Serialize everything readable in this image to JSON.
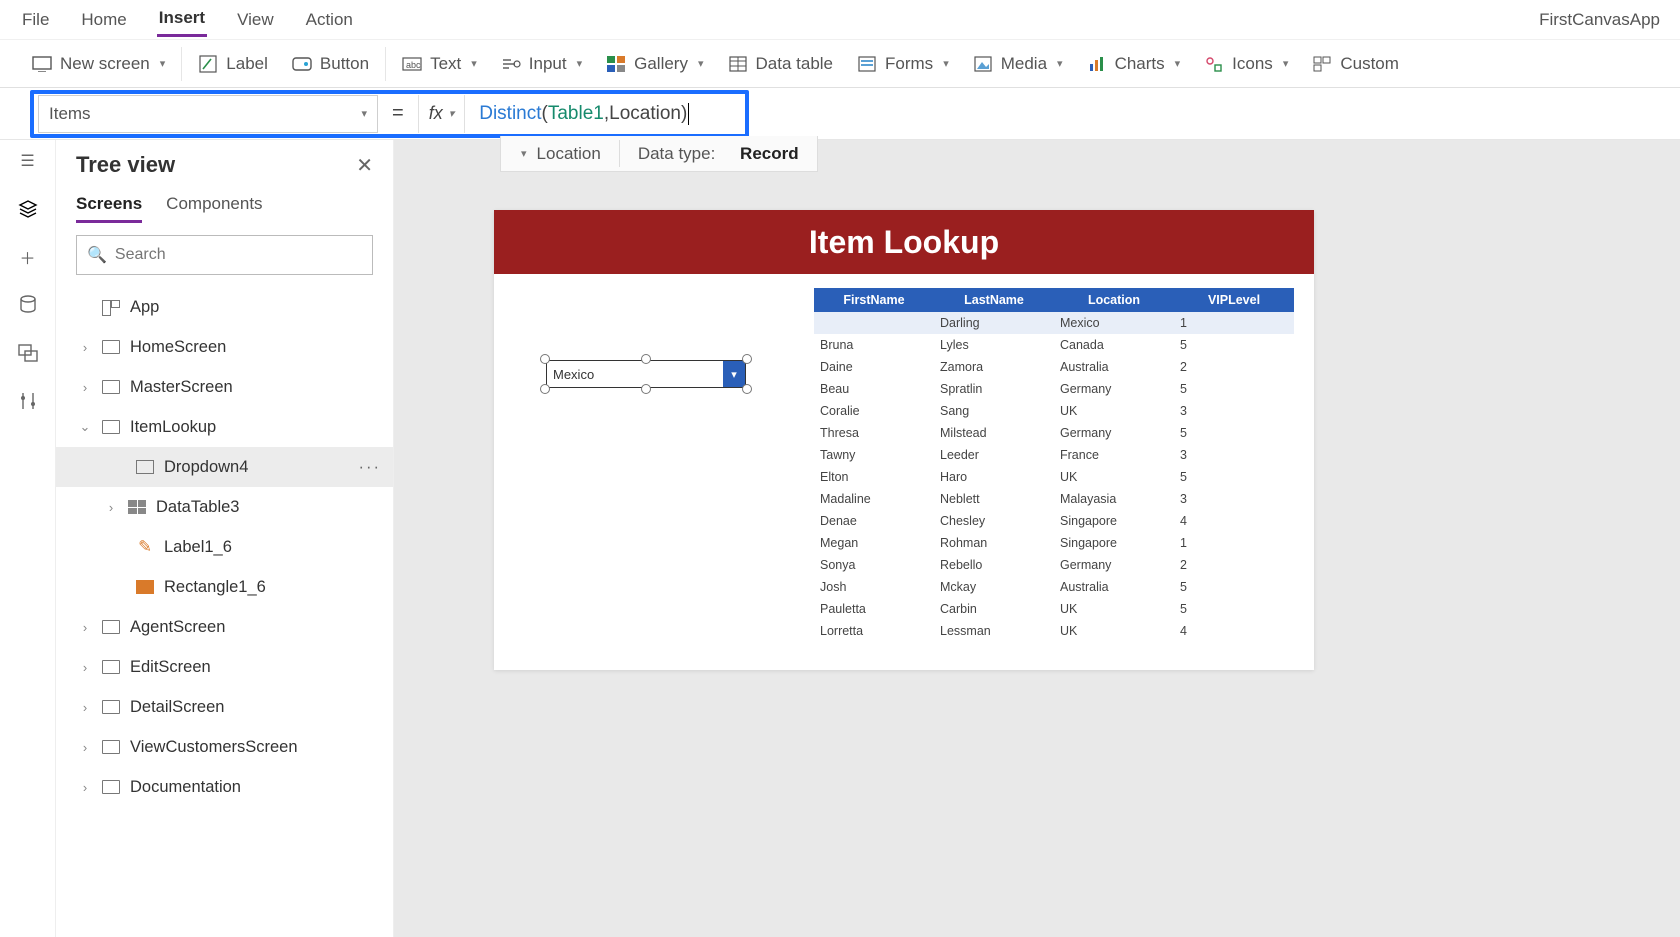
{
  "menu": {
    "items": [
      "File",
      "Home",
      "Insert",
      "View",
      "Action"
    ],
    "active": "Insert",
    "appname": "FirstCanvasApp"
  },
  "ribbon": {
    "newscreen": "New screen",
    "label": "Label",
    "button": "Button",
    "text": "Text",
    "input": "Input",
    "gallery": "Gallery",
    "datatable": "Data table",
    "forms": "Forms",
    "media": "Media",
    "charts": "Charts",
    "icons": "Icons",
    "custom": "Custom"
  },
  "formula": {
    "property": "Items",
    "fn": "Distinct",
    "table": "Table1",
    "column": "Location",
    "info_col": "Location",
    "datatype_label": "Data type:",
    "datatype_value": "Record"
  },
  "tree": {
    "title": "Tree view",
    "tabs": {
      "screens": "Screens",
      "components": "Components"
    },
    "search_placeholder": "Search",
    "items": {
      "app": "App",
      "home": "HomeScreen",
      "master": "MasterScreen",
      "itemlookup": "ItemLookup",
      "dropdown": "Dropdown4",
      "datatable": "DataTable3",
      "label": "Label1_6",
      "rect": "Rectangle1_6",
      "agent": "AgentScreen",
      "edit": "EditScreen",
      "detail": "DetailScreen",
      "viewcust": "ViewCustomersScreen",
      "doc": "Documentation"
    }
  },
  "canvas": {
    "title": "Item Lookup",
    "dropdown_value": "Mexico",
    "columns": [
      "FirstName",
      "LastName",
      "Location",
      "VIPLevel"
    ],
    "rows": [
      [
        "",
        "Darling",
        "Mexico",
        "1"
      ],
      [
        "Bruna",
        "Lyles",
        "Canada",
        "5"
      ],
      [
        "Daine",
        "Zamora",
        "Australia",
        "2"
      ],
      [
        "Beau",
        "Spratlin",
        "Germany",
        "5"
      ],
      [
        "Coralie",
        "Sang",
        "UK",
        "3"
      ],
      [
        "Thresa",
        "Milstead",
        "Germany",
        "5"
      ],
      [
        "Tawny",
        "Leeder",
        "France",
        "3"
      ],
      [
        "Elton",
        "Haro",
        "UK",
        "5"
      ],
      [
        "Madaline",
        "Neblett",
        "Malayasia",
        "3"
      ],
      [
        "Denae",
        "Chesley",
        "Singapore",
        "4"
      ],
      [
        "Megan",
        "Rohman",
        "Singapore",
        "1"
      ],
      [
        "Sonya",
        "Rebello",
        "Germany",
        "2"
      ],
      [
        "Josh",
        "Mckay",
        "Australia",
        "5"
      ],
      [
        "Pauletta",
        "Carbin",
        "UK",
        "5"
      ],
      [
        "Lorretta",
        "Lessman",
        "UK",
        "4"
      ]
    ]
  }
}
